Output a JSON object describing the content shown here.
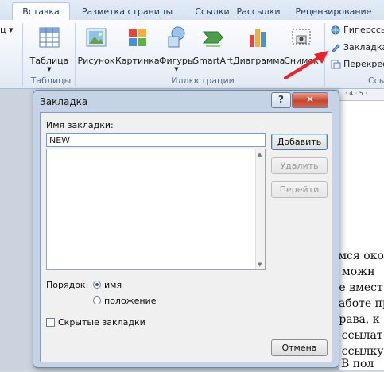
{
  "ribbon": {
    "tabs": [
      "Вставка",
      "Разметка страницы",
      "Ссылки",
      "Рассылки",
      "Рецензирование"
    ],
    "active_tab": "Вставка",
    "left_partial_label": "ц ▾",
    "buttons": {
      "table": "Таблица",
      "picture": "Рисунок",
      "clipart": "Картинка",
      "shapes": "Фигуры",
      "smartart": "SmartArt",
      "chart": "Диаграмма",
      "screenshot": "Снимок"
    },
    "groups": {
      "tables": "Таблицы",
      "illustrations": "Иллюстрации",
      "links_partial": "Ссы"
    },
    "links_items": [
      "Гиперссы",
      "Закладка",
      "Перекрест"
    ]
  },
  "ruler_marks": "· 4 · 5 ·",
  "doc_lines": [
    "емся  око",
    "о  можн",
    "ие вмест",
    "работе пр",
    "права,  к",
    "е ссылат",
    "е  ссылку",
    "?  В  пол"
  ],
  "dialog": {
    "title": "Закладка",
    "help_label": "?",
    "close_label": "✕",
    "name_label": "Имя закладки:",
    "name_value": "NEW",
    "add_button": "Добавить",
    "delete_button": "Удалить",
    "goto_button": "Перейти",
    "sort_label": "Порядок:",
    "sort_options": [
      "имя",
      "положение"
    ],
    "sort_selected": "имя",
    "hidden_label": "Скрытые закладки",
    "hidden_checked": false,
    "cancel_button": "Отмена"
  },
  "colors": {
    "accent_red_arrow": "#e8242a",
    "dialog_frame": "#c4d3e6",
    "close_button": "#c8442c"
  }
}
